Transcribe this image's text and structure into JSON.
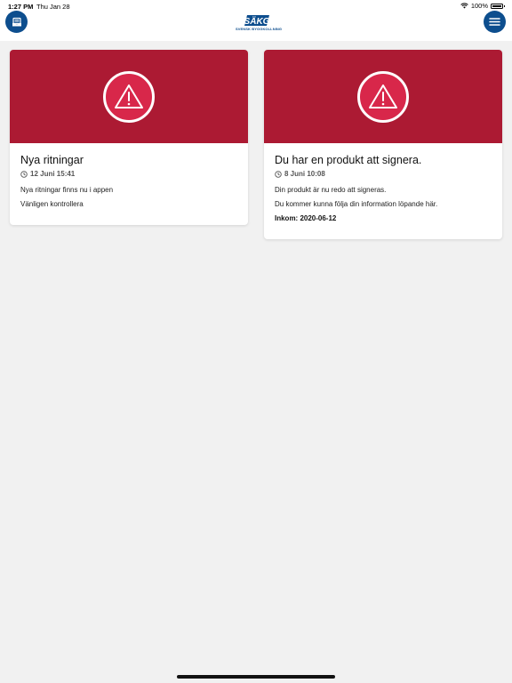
{
  "status_bar": {
    "time": "1:27 PM",
    "date": "Thu Jan 28",
    "battery": "100%"
  },
  "header": {
    "left_icon": "inbox-icon",
    "right_icon": "menu-icon",
    "logo_text": "SÄKG",
    "logo_sub": "SVENSK BYGGKOLLNING"
  },
  "colors": {
    "brand_blue": "#0d4e8e",
    "banner_red": "#ac1a33",
    "warn_red": "#d8274a"
  },
  "cards": [
    {
      "title": "Nya ritningar",
      "time": "12 Juni 15:41",
      "lines": [
        "Nya ritningar finns nu i appen",
        "Vänligen kontrollera"
      ],
      "icon": "warning-icon"
    },
    {
      "title": "Du har en produkt att signera.",
      "time": "8 Juni 10:08",
      "lines": [
        "Din produkt är nu redo att signeras.",
        "Du kommer kunna följa din information löpande här."
      ],
      "bold": "Inkom: 2020-06-12",
      "icon": "warning-icon"
    }
  ]
}
